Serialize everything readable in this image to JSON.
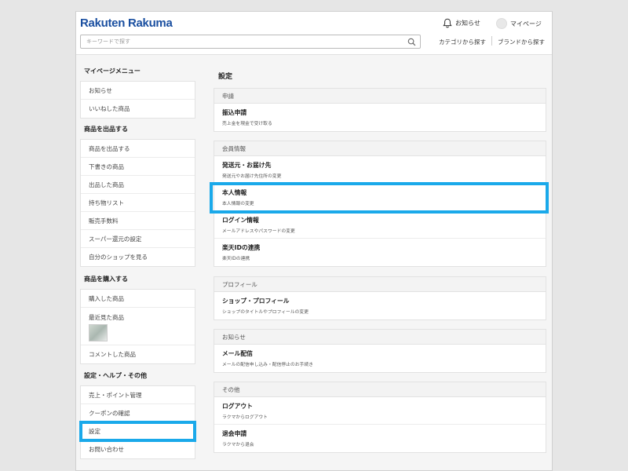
{
  "header": {
    "logo": "Rakuten Rakuma",
    "search_placeholder": "キーワードで探す",
    "notifications_label": "お知らせ",
    "mypage_label": "マイページ",
    "category_link": "カテゴリから探す",
    "brand_link": "ブランドから探す"
  },
  "sidebar": {
    "groups": [
      {
        "title": "マイページメニュー",
        "items": [
          "お知らせ",
          "いいねした商品"
        ]
      },
      {
        "title": "商品を出品する",
        "items": [
          "商品を出品する",
          "下書きの商品",
          "出品した商品",
          "持ち物リスト",
          "販売手数料",
          "スーパー還元の設定",
          "自分のショップを見る"
        ]
      },
      {
        "title": "商品を購入する",
        "items": [
          "購入した商品",
          "最近見た商品",
          "コメントした商品"
        ]
      },
      {
        "title": "設定・ヘルプ・その他",
        "items": [
          "売上・ポイント管理",
          "クーポンの確認",
          "設定",
          "お問い合わせ"
        ]
      }
    ]
  },
  "main": {
    "title": "設定",
    "sections": [
      {
        "title": "申請",
        "items": [
          {
            "title": "振込申請",
            "sub": "売上金を現金で受け取る"
          }
        ]
      },
      {
        "title": "会員情報",
        "items": [
          {
            "title": "発送元・お届け先",
            "sub": "発送元やお届け先住所の変更"
          },
          {
            "title": "本人情報",
            "sub": "本人情報の変更"
          },
          {
            "title": "ログイン情報",
            "sub": "メールアドレスやパスワードの変更"
          },
          {
            "title": "楽天IDの連携",
            "sub": "楽天IDの連携"
          }
        ]
      },
      {
        "title": "プロフィール",
        "items": [
          {
            "title": "ショップ・プロフィール",
            "sub": "ショップのタイトルやプロフィールの変更"
          }
        ]
      },
      {
        "title": "お知らせ",
        "items": [
          {
            "title": "メール配信",
            "sub": "メールの配信申し込み・配信停止のお手続き"
          }
        ]
      },
      {
        "title": "その他",
        "items": [
          {
            "title": "ログアウト",
            "sub": "ラクマからログアウト"
          },
          {
            "title": "退会申請",
            "sub": "ラクマから退会"
          }
        ]
      }
    ]
  },
  "colors": {
    "brand": "#1a4fa0",
    "highlight": "#1aa9ea",
    "page_bg": "#f5f5f5"
  }
}
